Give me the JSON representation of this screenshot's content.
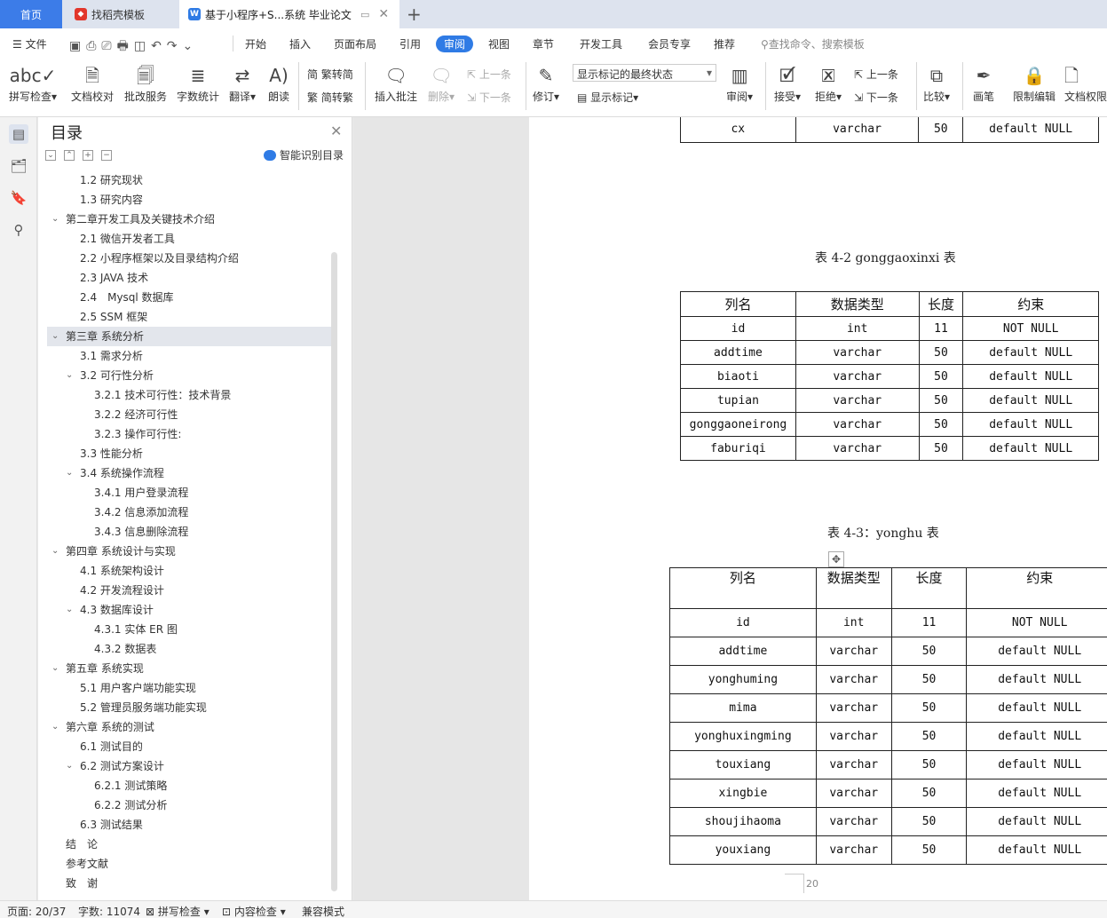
{
  "tabs": {
    "home": "首页",
    "daoke": "找稻壳模板",
    "doc": "基于小程序+S...系统 毕业论文"
  },
  "menu": {
    "file": "文件",
    "items": [
      "开始",
      "插入",
      "页面布局",
      "引用",
      "审阅",
      "视图",
      "章节",
      "开发工具",
      "会员专享",
      "推荐"
    ],
    "search": "查找命令、搜索模板"
  },
  "ribbon": {
    "spell": "拼写检查",
    "proof": "文档校对",
    "batch": "批改服务",
    "wordcount": "字数统计",
    "translate": "翻译",
    "read": "朗读",
    "trad": "繁转简",
    "simp": "简转繁",
    "insert_comment": "插入批注",
    "delete": "删除",
    "prev": "上一条",
    "next": "下一条",
    "revise": "修订",
    "markup_state": "显示标记的最终状态",
    "show_markup": "显示标记",
    "review": "审阅",
    "accept": "接受",
    "reject": "拒绝",
    "prev2": "上一条",
    "next2": "下一条",
    "compare": "比较",
    "pen": "画笔",
    "restrict": "限制编辑",
    "doc_perm": "文档权限"
  },
  "toc": {
    "title": "目录",
    "smart": "智能识别目录",
    "items": [
      "1.2 研究现状",
      "1.3 研究内容",
      "第二章开发工具及关键技术介绍",
      "2.1 微信开发者工具",
      "2.2 小程序框架以及目录结构介绍",
      "2.3 JAVA 技术",
      "2.4　Mysql 数据库",
      "2.5 SSM 框架",
      "第三章  系统分析",
      "3.1 需求分析",
      "3.2 可行性分析",
      "3.2.1 技术可行性：技术背景",
      "3.2.2 经济可行性",
      "3.2.3 操作可行性:",
      "3.3 性能分析",
      "3.4 系统操作流程",
      "3.4.1 用户登录流程",
      "3.4.2 信息添加流程",
      "3.4.3 信息删除流程",
      "第四章  系统设计与实现",
      "4.1 系统架构设计",
      "4.2 开发流程设计",
      "4.3 数据库设计",
      "4.3.1 实体 ER 图",
      "4.3.2 数据表",
      "第五章  系统实现",
      "5.1 用户客户端功能实现",
      "5.2  管理员服务端功能实现",
      "第六章    系统的测试",
      "6.1  测试目的",
      "6.2  测试方案设计",
      "6.2.1  测试策略",
      "6.2.2  测试分析",
      "6.3  测试结果",
      "结　论",
      "参考文献",
      "致　谢"
    ]
  },
  "doc": {
    "table0_row": [
      "cx",
      "varchar",
      "50",
      "default NULL"
    ],
    "caption2": "表 4-2 gonggaoxinxi 表",
    "table2_header": [
      "列名",
      "数据类型",
      "长度",
      "约束"
    ],
    "table2_rows": [
      [
        "id",
        "int",
        "11",
        "NOT NULL"
      ],
      [
        "addtime",
        "varchar",
        "50",
        "default NULL"
      ],
      [
        "biaoti",
        "varchar",
        "50",
        "default NULL"
      ],
      [
        "tupian",
        "varchar",
        "50",
        "default NULL"
      ],
      [
        "gonggaoneirong",
        "varchar",
        "50",
        "default NULL"
      ],
      [
        "faburiqi",
        "varchar",
        "50",
        "default NULL"
      ]
    ],
    "caption3": "表 4-3：yonghu 表",
    "table3_header": [
      "列名",
      "数据类型",
      "长度",
      "约束"
    ],
    "table3_rows": [
      [
        "id",
        "int",
        "11",
        "NOT NULL"
      ],
      [
        "addtime",
        "varchar",
        "50",
        "default NULL"
      ],
      [
        "yonghuming",
        "varchar",
        "50",
        "default NULL"
      ],
      [
        "mima",
        "varchar",
        "50",
        "default NULL"
      ],
      [
        "yonghuxingming",
        "varchar",
        "50",
        "default NULL"
      ],
      [
        "touxiang",
        "varchar",
        "50",
        "default NULL"
      ],
      [
        "xingbie",
        "varchar",
        "50",
        "default NULL"
      ],
      [
        "shoujihaoma",
        "varchar",
        "50",
        "default NULL"
      ],
      [
        "youxiang",
        "varchar",
        "50",
        "default NULL"
      ]
    ],
    "page_number": "20"
  },
  "status": {
    "page": "页面: 20/37",
    "words": "字数: 11074",
    "spell": "拼写检查",
    "content": "内容检查",
    "compat": "兼容模式"
  }
}
